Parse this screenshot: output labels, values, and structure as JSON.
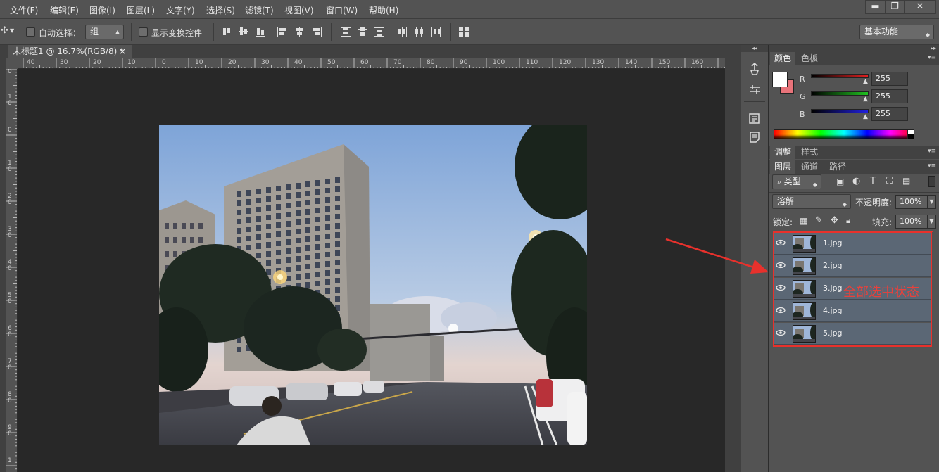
{
  "menu": [
    "文件(F)",
    "编辑(E)",
    "图像(I)",
    "图层(L)",
    "文字(Y)",
    "选择(S)",
    "滤镜(T)",
    "视图(V)",
    "窗口(W)",
    "帮助(H)"
  ],
  "window_controls": {
    "minimize": "▬",
    "restore": "❐",
    "close": "✕"
  },
  "options": {
    "auto_select_label": "自动选择：",
    "auto_select_value": "组",
    "show_transform_label": "显示变换控件",
    "workspace": "基本功能"
  },
  "document": {
    "tab_title": "未标题1 @ 16.7%(RGB/8) *",
    "close_glyph": "×"
  },
  "rulers": {
    "top_ticks": [
      "40",
      "30",
      "20",
      "10",
      "0",
      "10",
      "20",
      "30",
      "40",
      "50",
      "60",
      "70",
      "80",
      "90",
      "100",
      "110",
      "120",
      "130",
      "140",
      "150",
      "160"
    ],
    "left_ticks": [
      "0",
      "1 0",
      "0",
      "1 0",
      "2 0",
      "3 0",
      "4 0",
      "5 0",
      "6 0",
      "7 0",
      "8 0",
      "9 0",
      "1"
    ]
  },
  "color_panel": {
    "tabs": [
      "颜色",
      "色板"
    ],
    "channels": [
      {
        "label": "R",
        "value": "255",
        "color": "#e02020"
      },
      {
        "label": "G",
        "value": "255",
        "color": "#20c020"
      },
      {
        "label": "B",
        "value": "255",
        "color": "#2020e0"
      }
    ],
    "foreground": "#ffffff",
    "background": "#e8737a"
  },
  "adjust_panel": {
    "tabs": [
      "调整",
      "样式"
    ]
  },
  "layers_panel": {
    "tabs": [
      "图层",
      "通道",
      "路径"
    ],
    "filter_kind": "类型",
    "blend_mode": "溶解",
    "opacity_label": "不透明度:",
    "opacity_value": "100%",
    "lock_label": "锁定:",
    "fill_label": "填充:",
    "fill_value": "100%",
    "layers": [
      {
        "name": "1.jpg"
      },
      {
        "name": "2.jpg"
      },
      {
        "name": "3.jpg"
      },
      {
        "name": "4.jpg"
      },
      {
        "name": "5.jpg"
      }
    ]
  },
  "annotation": {
    "text": "全部选中状态",
    "color": "#e8413c"
  }
}
